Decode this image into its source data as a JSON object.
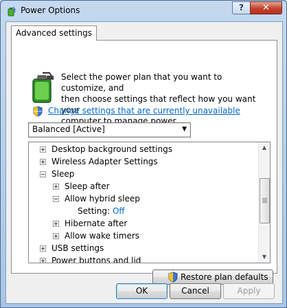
{
  "window": {
    "title": "Power Options",
    "help_label": "?",
    "close_label": "✕"
  },
  "tab": {
    "label": "Advanced settings"
  },
  "intro": {
    "line1": "Select the power plan that you want to customize, and",
    "line2": "then choose settings that reflect how you want your",
    "line3": "computer to manage power."
  },
  "change_link": "Change settings that are currently unavailable",
  "plan_select": {
    "value": "Balanced [Active]"
  },
  "tree": {
    "items": [
      {
        "label": "Desktop background settings",
        "state": "collapsed"
      },
      {
        "label": "Wireless Adapter Settings",
        "state": "collapsed"
      },
      {
        "label": "Sleep",
        "state": "expanded"
      },
      {
        "label": "Sleep after",
        "state": "collapsed"
      },
      {
        "label": "Allow hybrid sleep",
        "state": "expanded"
      },
      {
        "label": "Setting:",
        "value": "Off"
      },
      {
        "label": "Hibernate after",
        "state": "collapsed"
      },
      {
        "label": "Allow wake timers",
        "state": "collapsed"
      },
      {
        "label": "USB settings",
        "state": "collapsed"
      },
      {
        "label": "Power buttons and lid",
        "state": "collapsed"
      }
    ]
  },
  "restore_button": {
    "label": "Restore plan defaults"
  },
  "buttons": {
    "ok": "OK",
    "cancel": "Cancel",
    "apply": "Apply"
  },
  "colors": {
    "link": "#0066cc",
    "title_bar": "#b9d1ea",
    "close": "#c5412d"
  }
}
